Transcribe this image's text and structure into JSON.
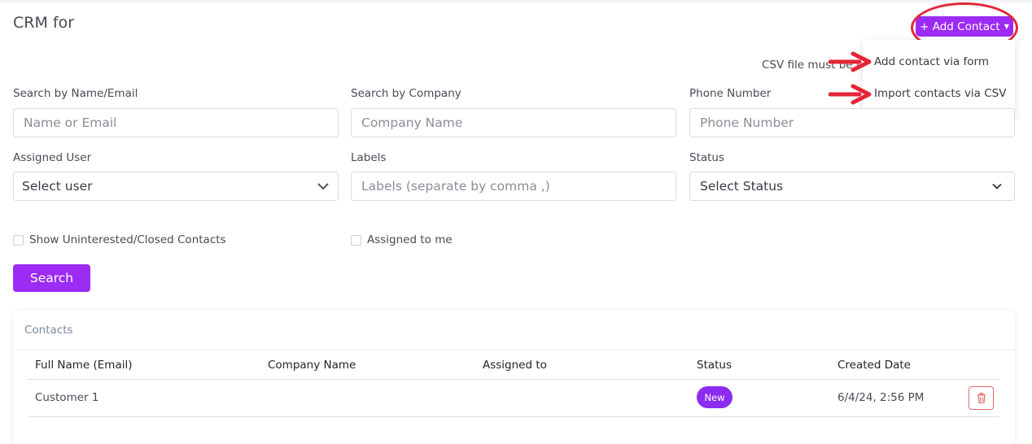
{
  "header": {
    "title": "CRM for",
    "add_contact_label": "+ Add Contact",
    "csv_note": "CSV file must be i"
  },
  "dropdown": {
    "items": [
      {
        "label": "Add contact via form"
      },
      {
        "label": "Import contacts via CSV"
      }
    ]
  },
  "filters": {
    "search_name": {
      "label": "Search by Name/Email",
      "placeholder": "Name or Email",
      "value": ""
    },
    "search_company": {
      "label": "Search by Company",
      "placeholder": "Company Name",
      "value": ""
    },
    "phone": {
      "label": "Phone Number",
      "placeholder": "Phone Number",
      "value": ""
    },
    "assigned_user": {
      "label": "Assigned User",
      "selected": "Select user"
    },
    "labels": {
      "label": "Labels",
      "placeholder": "Labels (separate by comma ,)",
      "value": ""
    },
    "status": {
      "label": "Status",
      "selected": "Select Status"
    },
    "show_closed": {
      "label": "Show Uninterested/Closed Contacts",
      "checked": false
    },
    "assigned_to_me": {
      "label": "Assigned to me",
      "checked": false
    },
    "search_button": "Search"
  },
  "contacts": {
    "title": "Contacts",
    "columns": [
      "Full Name (Email)",
      "Company Name",
      "Assigned to",
      "Status",
      "Created Date"
    ],
    "rows": [
      {
        "name": "Customer 1",
        "company": "",
        "assigned": "",
        "status": "New",
        "created": "6/4/24, 2:56 PM"
      }
    ]
  },
  "colors": {
    "accent": "#9c2cf3",
    "badge": "#8b2cf0",
    "annotation": "#e32636",
    "delete": "#e06a6a"
  },
  "icons": {
    "caret": "caret-down-icon",
    "chevron": "chevron-down-icon",
    "delete": "trash-icon",
    "annotation_arrow": "right-arrow-icon"
  }
}
